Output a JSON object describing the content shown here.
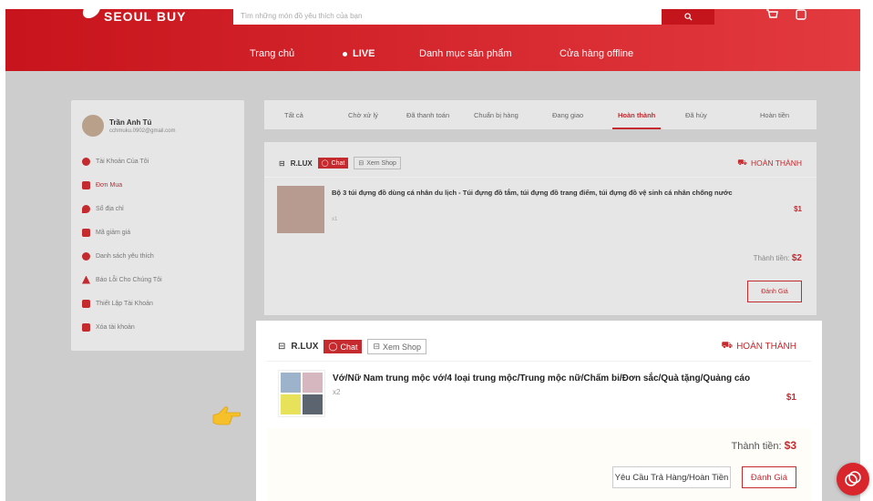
{
  "header": {
    "logo": "SEOUL BUY",
    "search_placeholder": "Tìm những món đồ yêu thích của bạn",
    "nav": [
      "Trang chủ",
      "LIVE",
      "Danh mục sản phẩm",
      "Cửa hàng offline"
    ]
  },
  "sidebar": {
    "name": "Trần Anh Tú",
    "email": "cchmuku.0902@gmail.com",
    "items": [
      {
        "label": "Tài Khoản Của Tôi",
        "icon": "user-icon"
      },
      {
        "label": "Đơn Mua",
        "icon": "order-icon"
      },
      {
        "label": "Sổ địa chỉ",
        "icon": "location-icon"
      },
      {
        "label": "Mã giảm giá",
        "icon": "voucher-icon"
      },
      {
        "label": "Danh sách yêu thích",
        "icon": "heart-icon"
      },
      {
        "label": "Báo Lỗi Cho Chúng Tôi",
        "icon": "warning-icon"
      },
      {
        "label": "Thiết Lập Tài Khoản",
        "icon": "settings-icon"
      },
      {
        "label": "Xóa tài khoản",
        "icon": "trash-icon"
      }
    ]
  },
  "tabs": [
    "Tất cả",
    "Chờ xử lý",
    "Đã thanh toán",
    "Chuẩn bị hàng",
    "Đang giao",
    "Hoàn thành",
    "Đã hủy",
    "Hoàn tiền"
  ],
  "orders": [
    {
      "shop": "R.LUX",
      "chat": "Chat",
      "view_shop": "Xem Shop",
      "status": "HOÀN THÀNH",
      "product": "Bộ 3 túi đựng đồ dùng cá nhân du lịch - Túi đựng đồ tắm, túi đựng đồ trang điểm, túi đựng đồ vệ sinh cá nhân chống nước",
      "qty": "x1",
      "price": "$1",
      "total_label": "Thành tiền:",
      "total": "$2",
      "rate": "Đánh Giá"
    },
    {
      "shop": "R.LUX",
      "chat": "Chat",
      "view_shop": "Xem Shop",
      "status": "HOÀN THÀNH",
      "product": "Vớ/Nữ Nam trung mộc vớ/4 loại trung mộc/Trung mộc nữ/Chấm bi/Đơn sắc/Quà tặng/Quảng cáo",
      "qty": "x2",
      "price": "$1",
      "total_label": "Thành tiền:",
      "total": "$3",
      "refund": "Yêu Cầu Trả Hàng/Hoàn Tiền",
      "rate": "Đánh Giá"
    }
  ]
}
